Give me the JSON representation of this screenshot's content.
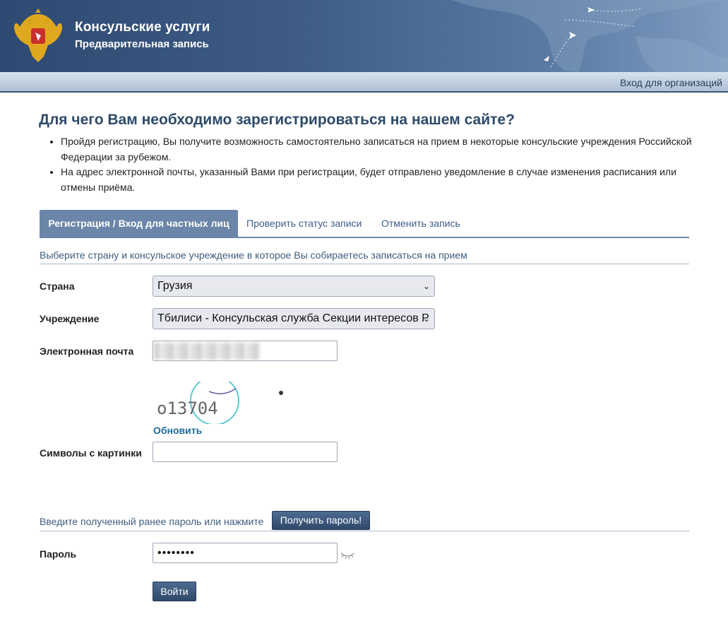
{
  "header": {
    "title": "Консульские услуги",
    "subtitle": "Предварительная запись",
    "org_login": "Вход для организаций"
  },
  "main": {
    "title": "Для чего Вам необходимо зарегистрироваться на нашем сайте?",
    "bullets": [
      "Пройдя регистрацию, Вы получите возможность самостоятельно записаться на прием в некоторые консульские учреждения Российской Федерации за рубежом.",
      "На адрес электронной почты, указанный Вами при регистрации, будет отправлено уведомление в случае изменения расписания или отмены приёма."
    ]
  },
  "tabs": [
    {
      "label": "Регистрация / Вход для частных лиц",
      "active": true
    },
    {
      "label": "Проверить статус записи",
      "active": false
    },
    {
      "label": "Отменить запись",
      "active": false
    }
  ],
  "form": {
    "section_hint": "Выберите страну и консульское учреждение в которое Вы собираетесь записаться на прием",
    "country_label": "Страна",
    "country_value": "Грузия",
    "institution_label": "Учреждение",
    "institution_value": "Тбилиси - Консульская служба Секции интересов Р",
    "email_label": "Электронная почта",
    "captcha_text": "o13704",
    "refresh_label": "Обновить",
    "captcha_input_label": "Символы с картинки",
    "password_hint": "Введите полученный ранее пароль или нажмите",
    "get_password_button": "Получить пароль!",
    "password_label": "Пароль",
    "password_value": "••••••••",
    "login_button": "Войти"
  },
  "colors": {
    "header_dark": "#2e4a72",
    "tab_active": "#6b86a8",
    "link": "#1f6c9c",
    "button": "#3a5478"
  }
}
